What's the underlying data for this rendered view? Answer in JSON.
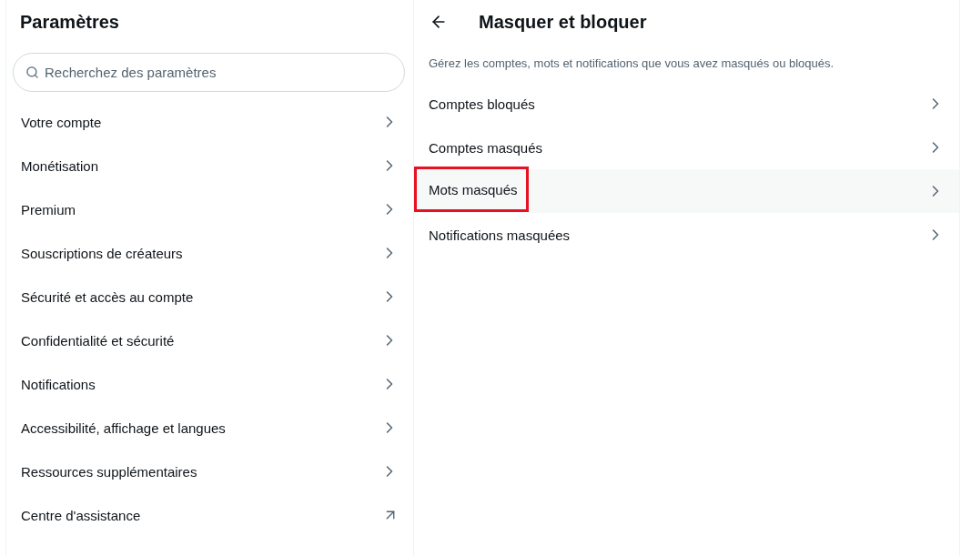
{
  "settings": {
    "title": "Paramètres",
    "search": {
      "placeholder": "Recherchez des paramètres"
    },
    "items": [
      {
        "label": "Votre compte",
        "kind": "nav"
      },
      {
        "label": "Monétisation",
        "kind": "nav"
      },
      {
        "label": "Premium",
        "kind": "nav"
      },
      {
        "label": "Souscriptions de créateurs",
        "kind": "nav"
      },
      {
        "label": "Sécurité et accès au compte",
        "kind": "nav"
      },
      {
        "label": "Confidentialité et sécurité",
        "kind": "nav"
      },
      {
        "label": "Notifications",
        "kind": "nav"
      },
      {
        "label": "Accessibilité, affichage et langues",
        "kind": "nav"
      },
      {
        "label": "Ressources supplémentaires",
        "kind": "nav"
      },
      {
        "label": "Centre d'assistance",
        "kind": "external"
      }
    ]
  },
  "detail": {
    "title": "Masquer et bloquer",
    "description": "Gérez les comptes, mots et notifications que vous avez masqués ou bloqués.",
    "items": [
      {
        "label": "Comptes bloqués",
        "selected": false,
        "marked": false
      },
      {
        "label": "Comptes masqués",
        "selected": false,
        "marked": false
      },
      {
        "label": "Mots masqués",
        "selected": true,
        "marked": true
      },
      {
        "label": "Notifications masquées",
        "selected": false,
        "marked": false
      }
    ]
  }
}
